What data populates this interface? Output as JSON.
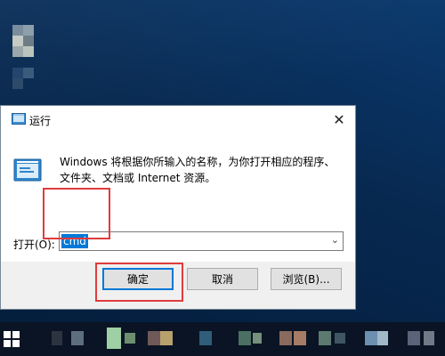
{
  "dialog": {
    "title": "运行",
    "close_glyph": "✕",
    "description": "Windows 将根据你所输入的名称，为你打开相应的程序、文件夹、文档或 Internet 资源。",
    "open_label": "打开(O):",
    "input_value": "cmd",
    "dropdown_glyph": "⌄",
    "buttons": {
      "ok": "确定",
      "cancel": "取消",
      "browse": "浏览(B)..."
    }
  },
  "colors": {
    "highlight_red": "#e03c3c",
    "selection_blue": "#0078d7"
  },
  "icons": {
    "dialog": "run-icon",
    "close": "close-icon",
    "dropdown": "chevron-down-icon",
    "start": "windows-logo-icon"
  }
}
